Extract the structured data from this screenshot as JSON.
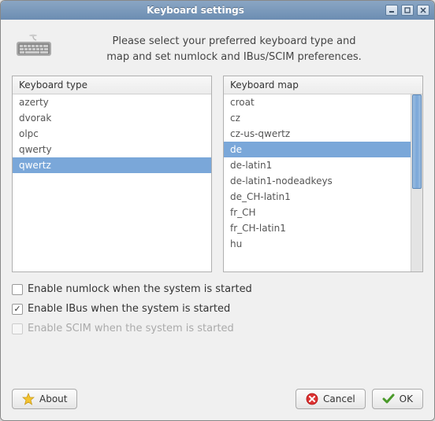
{
  "window": {
    "title": "Keyboard settings"
  },
  "header": {
    "line1": "Please select your preferred keyboard type and",
    "line2": "map and set numlock and IBus/SCIM preferences."
  },
  "lists": {
    "type": {
      "header": "Keyboard type",
      "items": [
        "azerty",
        "dvorak",
        "olpc",
        "qwerty",
        "qwertz"
      ],
      "selected": "qwertz"
    },
    "map": {
      "header": "Keyboard map",
      "items": [
        "croat",
        "cz",
        "cz-us-qwertz",
        "de",
        "de-latin1",
        "de-latin1-nodeadkeys",
        "de_CH-latin1",
        "fr_CH",
        "fr_CH-latin1",
        "hu"
      ],
      "selected": "de",
      "scroll_thumb_height": 120
    }
  },
  "checks": {
    "numlock": {
      "label": "Enable numlock when the system is started",
      "checked": false,
      "disabled": false
    },
    "ibus": {
      "label": "Enable IBus when the system is started",
      "checked": true,
      "disabled": false
    },
    "scim": {
      "label": "Enable SCIM when the system is started",
      "checked": false,
      "disabled": true
    }
  },
  "buttons": {
    "about": "About",
    "cancel": "Cancel",
    "ok": "OK"
  }
}
